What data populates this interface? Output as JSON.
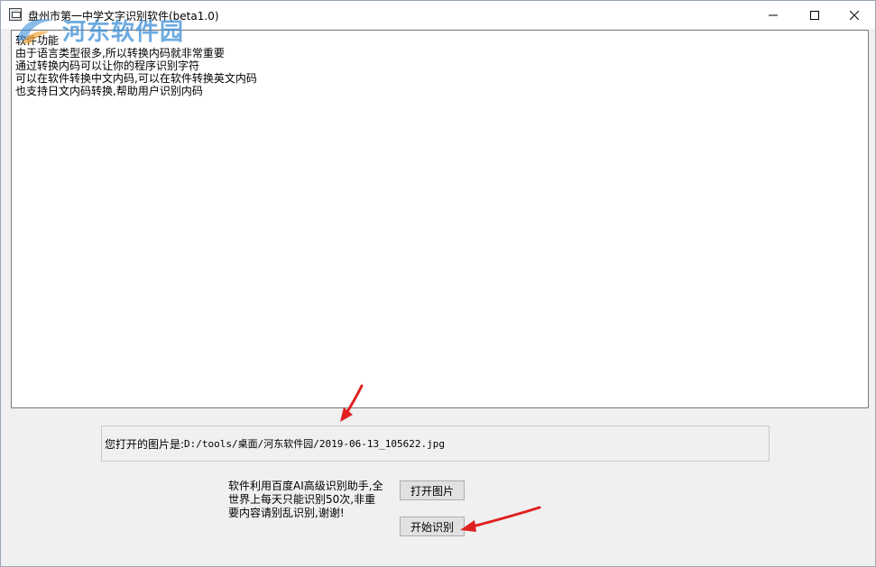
{
  "window": {
    "title": "盘州市第一中学文字识别软件(beta1.0)",
    "minimize_icon": "minimize-icon",
    "maximize_icon": "maximize-icon",
    "close_icon": "close-icon"
  },
  "watermark": {
    "text": "河东软件园"
  },
  "output": {
    "lines": [
      "软件功能",
      "由于语言类型很多,所以转换内码就非常重要",
      "通过转换内码可以让你的程序识别字符",
      "可以在软件转换中文内码,可以在软件转换英文内码",
      "也支持日文内码转换,帮助用户识别内码"
    ]
  },
  "file": {
    "label": "您打开的图片是: ",
    "path": "D:/tools/桌面/河东软件园/2019-06-13_105622.jpg"
  },
  "note": "软件利用百度AI高级识别助手,全世界上每天只能识别50次,非重要内容请别乱识别,谢谢!",
  "buttons": {
    "open_image": "打开图片",
    "start_recognize": "开始识别"
  },
  "colors": {
    "annotation_arrow": "#e02020",
    "watermark": "#3d8fd8"
  }
}
